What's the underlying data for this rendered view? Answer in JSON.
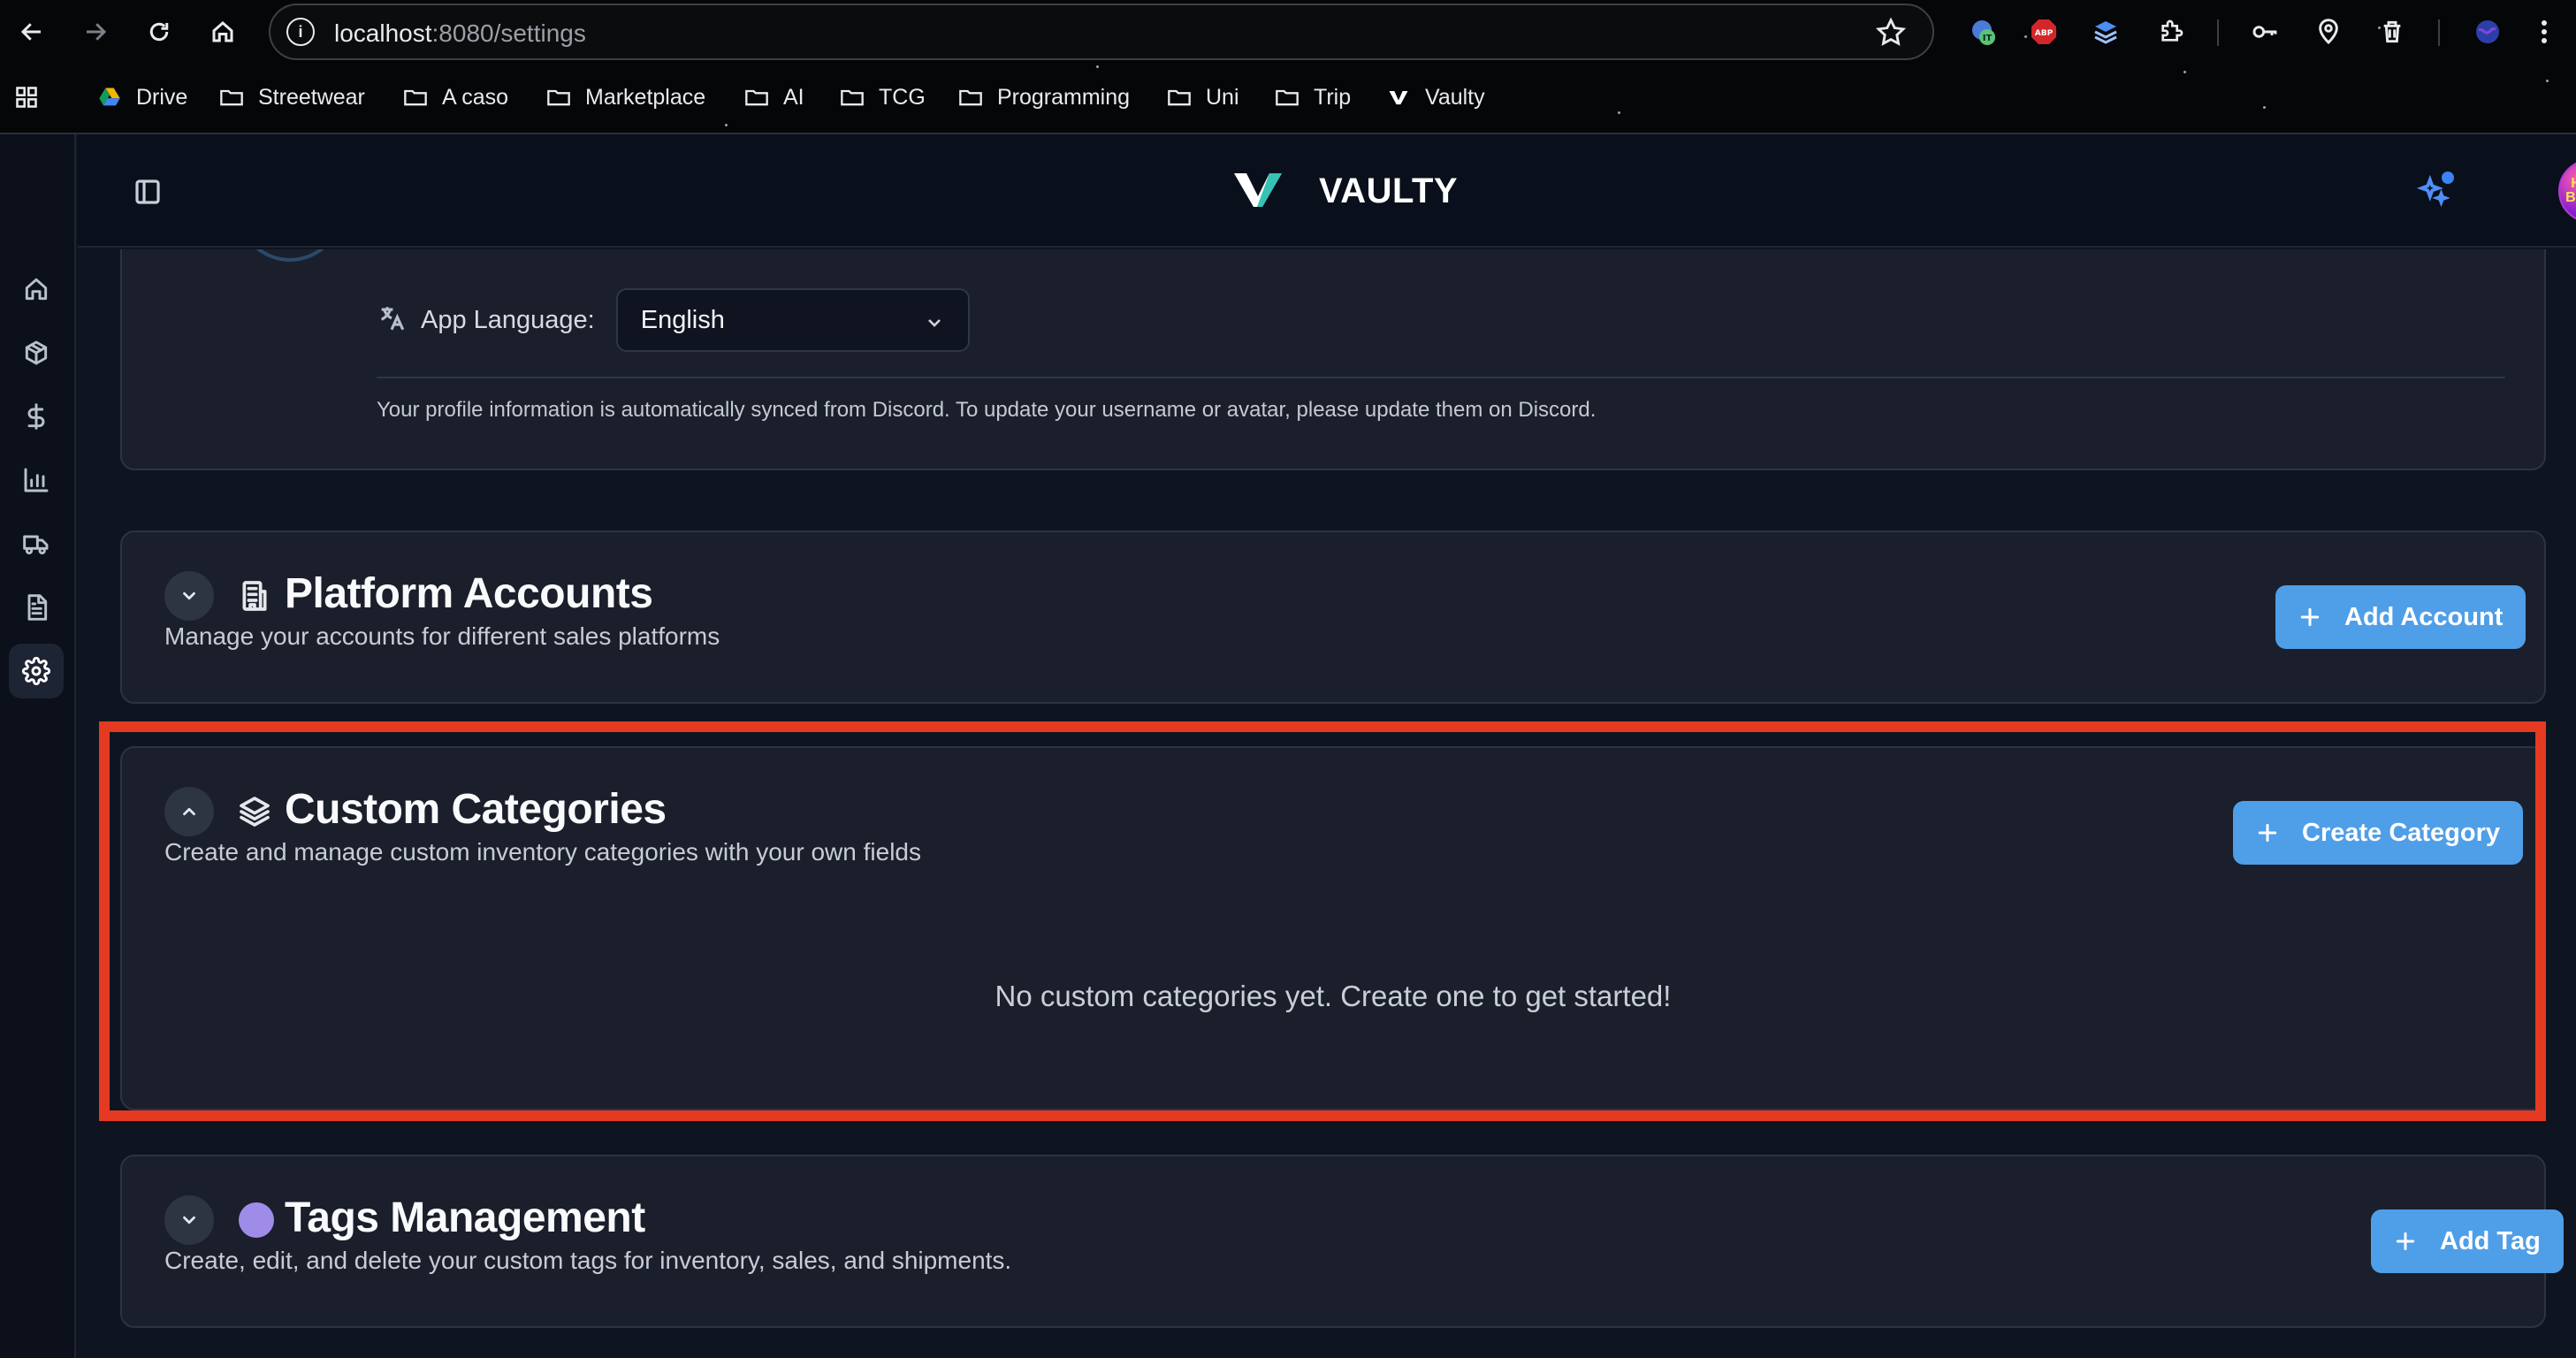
{
  "browser": {
    "url_host": "localhost",
    "url_rest": ":8080/settings",
    "extension_badges": {
      "it": "IT",
      "abp": "ABP"
    },
    "bookmarks": [
      {
        "label": "Drive",
        "icon": "drive-icon"
      },
      {
        "label": "Streetwear",
        "icon": "folder-icon"
      },
      {
        "label": "A caso",
        "icon": "folder-icon"
      },
      {
        "label": "Marketplace",
        "icon": "folder-icon"
      },
      {
        "label": "AI",
        "icon": "folder-icon"
      },
      {
        "label": "TCG",
        "icon": "folder-icon"
      },
      {
        "label": "Programming",
        "icon": "folder-icon"
      },
      {
        "label": "Uni",
        "icon": "folder-icon"
      },
      {
        "label": "Trip",
        "icon": "folder-icon"
      },
      {
        "label": "Vaulty",
        "icon": "vaulty-icon"
      }
    ]
  },
  "app": {
    "brand": "VAULTY",
    "avatar_text": "HYPE BOTTO",
    "sidebar": [
      {
        "name": "home",
        "icon": "home-icon"
      },
      {
        "name": "inventory",
        "icon": "package-icon"
      },
      {
        "name": "sales",
        "icon": "dollar-icon"
      },
      {
        "name": "analytics",
        "icon": "bar-chart-icon"
      },
      {
        "name": "shipments",
        "icon": "truck-icon"
      },
      {
        "name": "reports",
        "icon": "document-icon"
      },
      {
        "name": "settings",
        "icon": "gear-icon",
        "active": true
      }
    ]
  },
  "profile": {
    "language_label": "App Language:",
    "language_value": "English",
    "note": "Your profile information is automatically synced from Discord. To update your username or avatar, please update them on Discord."
  },
  "platform_accounts": {
    "title": "Platform Accounts",
    "description": "Manage your accounts for different sales platforms",
    "button": "Add Account"
  },
  "custom_categories": {
    "title": "Custom Categories",
    "description": "Create and manage custom inventory categories with your own fields",
    "button": "Create Category",
    "empty_message": "No custom categories yet. Create one to get started!"
  },
  "tags_management": {
    "title": "Tags Management",
    "description": "Create, edit, and delete your custom tags for inventory, sales, and shipments.",
    "button": "Add Tag"
  },
  "colors": {
    "accent_button": "#4f9ee8",
    "highlight_box": "#e53a22",
    "tag_dot": "#9f8ce8",
    "card_bg": "#1a1f2b"
  }
}
